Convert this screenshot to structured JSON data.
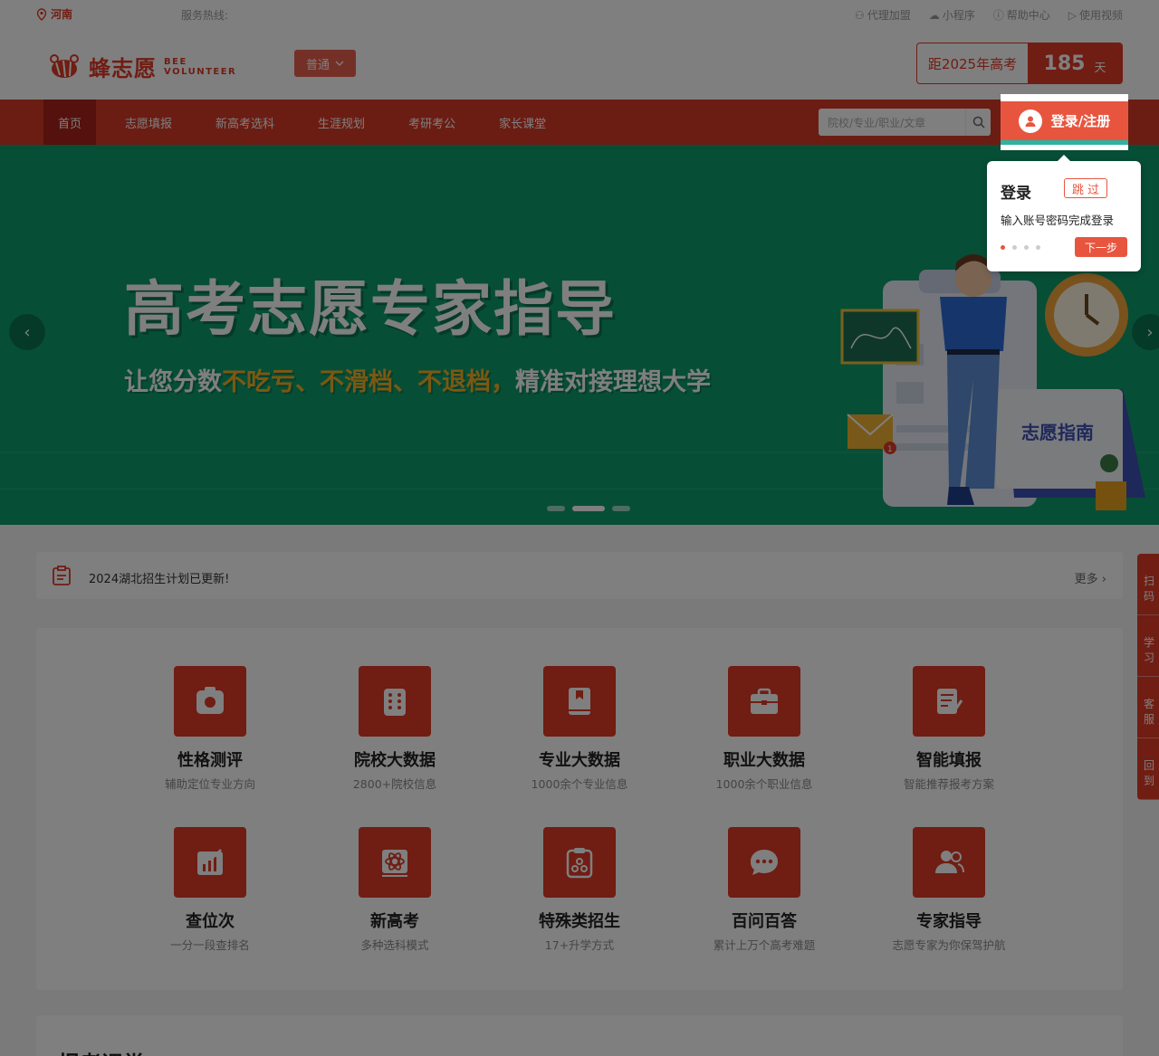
{
  "topbar": {
    "region": "河南",
    "hotline_label": "服务热线:",
    "links": [
      "代理加盟",
      "小程序",
      "帮助中心",
      "使用视频"
    ]
  },
  "header": {
    "logo_cn": "蜂志愿",
    "logo_en_line1": "BEE",
    "logo_en_line2": "VOLUNTEER",
    "level_select": "普通",
    "countdown_label": "距2025年高考",
    "countdown_days": "185",
    "countdown_unit": "天"
  },
  "nav": {
    "items": [
      "首页",
      "志愿填报",
      "新高考选科",
      "生涯规划",
      "考研考公",
      "家长课堂"
    ],
    "search_placeholder": "院校/专业/职业/文章",
    "login_label": "登录/注册"
  },
  "tip": {
    "title": "登录",
    "skip": "跳 过",
    "desc": "输入账号密码完成登录",
    "next": "下一步"
  },
  "banner": {
    "headline": "高考志愿专家指导",
    "sub_prefix": "让您分数",
    "sub_highlight": "不吃亏、不滑档、不退档，",
    "sub_suffix": "精准对接理想大学",
    "board_label": "志愿指南",
    "mail_badge": "1"
  },
  "notice": {
    "text": "2024湖北招生计划已更新!",
    "more": "更多"
  },
  "features": [
    {
      "name": "性格测评",
      "desc": "辅助定位专业方向",
      "icon": "personality-icon"
    },
    {
      "name": "院校大数据",
      "desc": "2800+院校信息",
      "icon": "school-icon"
    },
    {
      "name": "专业大数据",
      "desc": "1000余个专业信息",
      "icon": "book-icon"
    },
    {
      "name": "职业大数据",
      "desc": "1000余个职业信息",
      "icon": "briefcase-icon"
    },
    {
      "name": "智能填报",
      "desc": "智能推荐报考方案",
      "icon": "edit-icon"
    },
    {
      "name": "查位次",
      "desc": "一分一段查排名",
      "icon": "chart-icon"
    },
    {
      "name": "新高考",
      "desc": "多种选科模式",
      "icon": "atom-icon"
    },
    {
      "name": "特殊类招生",
      "desc": "17+升学方式",
      "icon": "clipboard-icon"
    },
    {
      "name": "百问百答",
      "desc": "累计上万个高考难题",
      "icon": "chat-icon"
    },
    {
      "name": "专家指导",
      "desc": "志愿专家为你保驾护航",
      "icon": "users-icon"
    }
  ],
  "bottom": {
    "title": "报考课堂"
  },
  "sidebar": [
    "扫码",
    "学习",
    "客服",
    "回到"
  ],
  "colors": {
    "brand": "#e03a26",
    "nav": "#d63b27",
    "banner": "#0f9d6c",
    "accent": "#f7b125"
  }
}
